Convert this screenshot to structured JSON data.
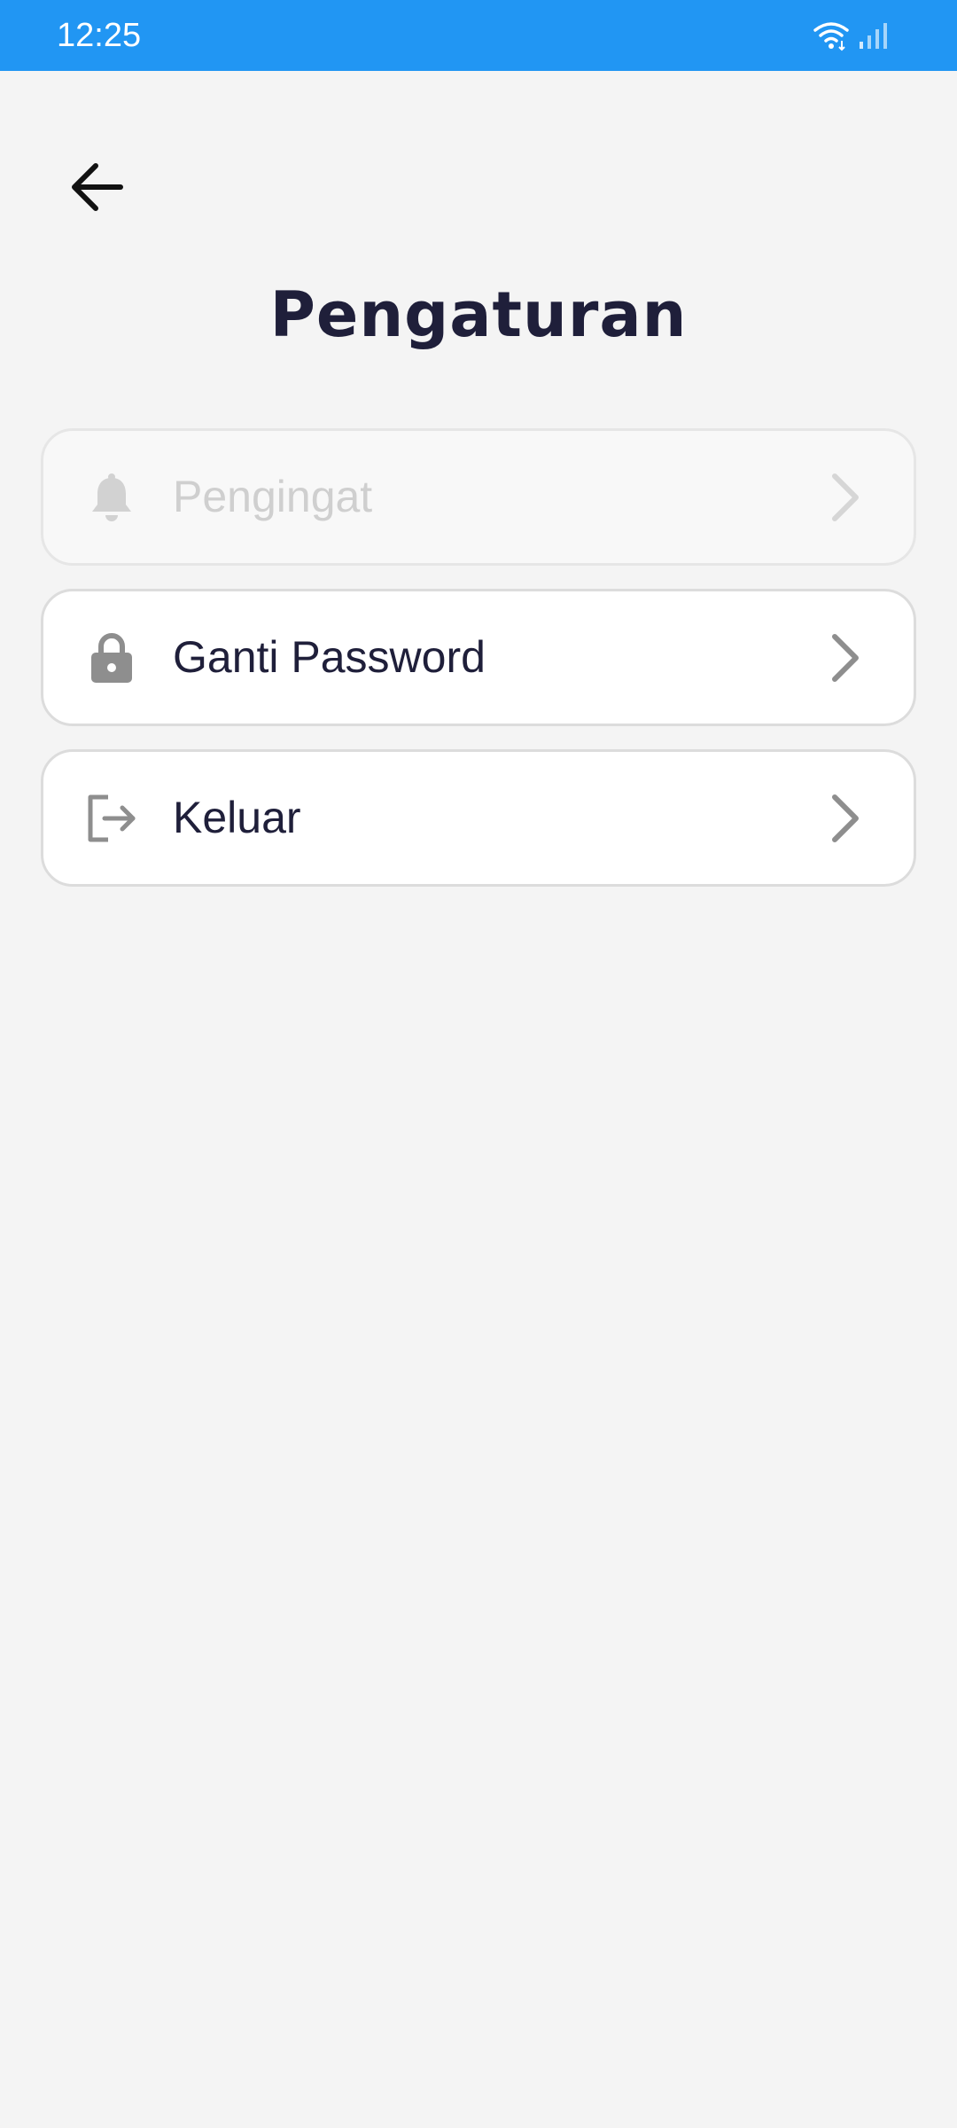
{
  "status_bar": {
    "time": "12:25",
    "background_color": "#2196f3",
    "icons": [
      "wifi-icon",
      "signal-icon"
    ]
  },
  "header": {
    "back_icon": "arrow-left-icon",
    "title": "Pengaturan"
  },
  "menu": {
    "items": [
      {
        "label": "Pengingat",
        "icon": "bell-icon",
        "state": "disabled"
      },
      {
        "label": "Ganti Password",
        "icon": "lock-icon",
        "state": "enabled"
      },
      {
        "label": "Keluar",
        "icon": "logout-icon",
        "state": "enabled"
      }
    ]
  },
  "colors": {
    "title_text": "#1f1f3a",
    "disabled_text": "#cfcfcf",
    "icon_gray": "#8e8e8e",
    "page_background": "#f4f4f4"
  }
}
